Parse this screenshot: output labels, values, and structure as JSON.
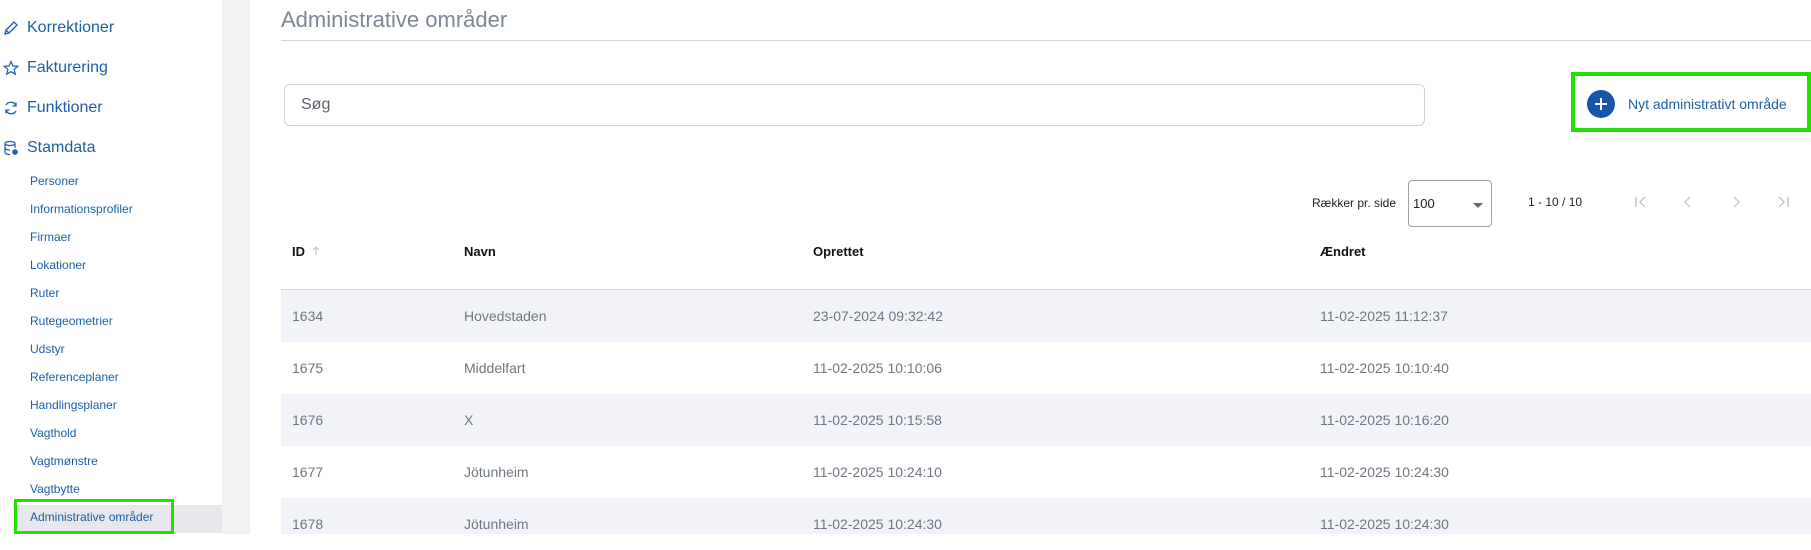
{
  "sidebar": {
    "top_items": [
      {
        "label": "Korrektioner",
        "icon": "pencil-icon"
      },
      {
        "label": "Fakturering",
        "icon": "star-icon"
      },
      {
        "label": "Funktioner",
        "icon": "refresh-icon"
      },
      {
        "label": "Stamdata",
        "icon": "database-icon"
      }
    ],
    "sub_items": [
      {
        "label": "Personer"
      },
      {
        "label": "Informationsprofiler"
      },
      {
        "label": "Firmaer"
      },
      {
        "label": "Lokationer"
      },
      {
        "label": "Ruter"
      },
      {
        "label": "Rutegeometrier"
      },
      {
        "label": "Udstyr"
      },
      {
        "label": "Referenceplaner"
      },
      {
        "label": "Handlingsplaner"
      },
      {
        "label": "Vagthold"
      },
      {
        "label": "Vagtmønstre"
      },
      {
        "label": "Vagtbytte"
      },
      {
        "label": "Administrative områder"
      }
    ],
    "active_item": "Administrative områder"
  },
  "main": {
    "title": "Administrative områder",
    "search_placeholder": "Søg",
    "new_button_label": "Nyt administrativt område",
    "pagination": {
      "rows_per_page_label": "Rækker pr. side",
      "rows_per_page_value": "100",
      "range_text": "1 - 10 / 10"
    },
    "table": {
      "columns": [
        "ID",
        "Navn",
        "Oprettet",
        "Ændret"
      ],
      "sort_column": "ID",
      "rows": [
        {
          "id": "1634",
          "name": "Hovedstaden",
          "created": "23-07-2024 09:32:42",
          "modified": "11-02-2025 11:12:37"
        },
        {
          "id": "1675",
          "name": "Middelfart",
          "created": "11-02-2025 10:10:06",
          "modified": "11-02-2025 10:10:40"
        },
        {
          "id": "1676",
          "name": "X",
          "created": "11-02-2025 10:15:58",
          "modified": "11-02-2025 10:16:20"
        },
        {
          "id": "1677",
          "name": "Jötunheim",
          "created": "11-02-2025 10:24:10",
          "modified": "11-02-2025 10:24:30"
        },
        {
          "id": "1678",
          "name": "Jötunheim",
          "created": "11-02-2025 10:24:30",
          "modified": "11-02-2025 10:24:30"
        }
      ]
    }
  },
  "colors": {
    "accent": "#1d5fa8",
    "highlight": "#22e000",
    "row_shade": "#f1f3f9"
  }
}
